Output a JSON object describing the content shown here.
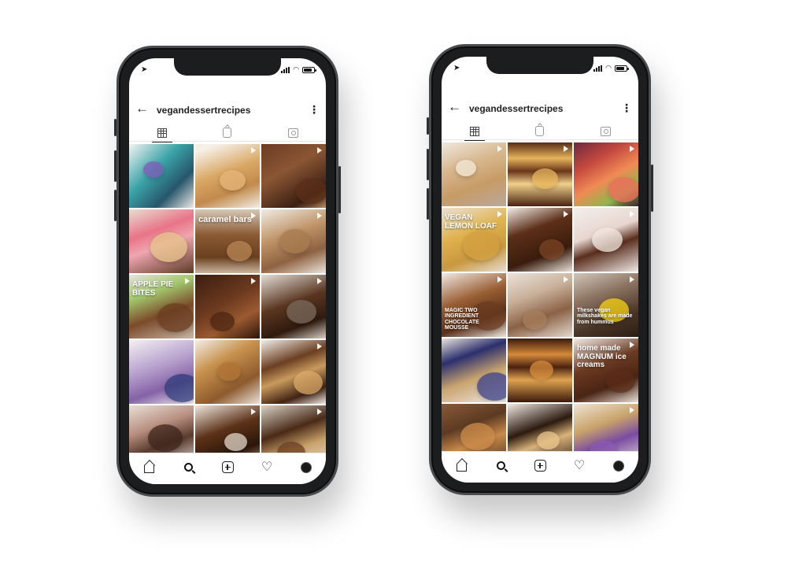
{
  "phones": [
    {
      "username": "vegandessertrecipes",
      "header": {
        "back_icon": "arrow-left-icon",
        "more_icon": "more-vertical-icon"
      },
      "tabs": [
        "grid-icon",
        "igtv-icon",
        "tagged-icon"
      ],
      "posts": [
        {
          "bg": "linear-gradient(135deg,#f4f4f4 0%,#3aa3a8 40%,#27566b 70%,#efe9e6 100%)",
          "video": false,
          "overlay": "",
          "accent": "#7f5ab8"
        },
        {
          "bg": "linear-gradient(160deg,#f6efe6 10%,#d9a764 45%,#c28a4c 70%,#f3ece4 100%)",
          "video": true,
          "overlay": "",
          "accent": "#e6b579"
        },
        {
          "bg": "linear-gradient(150deg,#6b3b23 0%,#8a5634 40%,#3c1f12 80%,#b98a62 100%)",
          "video": true,
          "overlay": "",
          "accent": "#5a2e16"
        },
        {
          "bg": "linear-gradient(160deg,#e8ddd1 0%,#e87487 35%,#f0a6b0 55%,#5c3a25 100%)",
          "video": false,
          "overlay": "",
          "accent": "#e6c58a"
        },
        {
          "bg": "linear-gradient(180deg,#d6c7b5 0%,#8b5a33 40%,#6a401f 75%,#cbb6a0 100%)",
          "video": true,
          "overlay": "caramel bars",
          "accent": "#b88655"
        },
        {
          "bg": "linear-gradient(160deg,#f1ebe4 0%,#bf9468 40%,#8e6241 70%,#ece4dc 100%)",
          "video": true,
          "overlay": "",
          "accent": "#a77a4e"
        },
        {
          "bg": "linear-gradient(160deg,#e7e3de 0%,#a2c66c 30%,#7b4a2a 60%,#c8b6a6 100%)",
          "video": true,
          "overlay": "APPLE PIE BITES",
          "accent": "#6a3c20"
        },
        {
          "bg": "linear-gradient(150deg,#3b1d10 0%,#6d3a1f 45%,#9b5a31 70%,#2d150a 100%)",
          "video": true,
          "overlay": "",
          "accent": "#4b2412"
        },
        {
          "bg": "linear-gradient(160deg,#e3ded8 0%,#5a3620 45%,#2f1a0e 75%,#d7cfc5 100%)",
          "video": true,
          "overlay": "",
          "accent": "#7a6a5c"
        },
        {
          "bg": "linear-gradient(160deg,#f5f0f3 0%,#b9a3cf 40%,#8462a6 70%,#f1ecef 100%)",
          "video": false,
          "overlay": "",
          "accent": "#2d3b7a"
        },
        {
          "bg": "linear-gradient(150deg,#f3ede6 0%,#c8924e 35%,#8d5a2d 70%,#eae3db 100%)",
          "video": false,
          "overlay": "",
          "accent": "#b07234"
        },
        {
          "bg": "linear-gradient(160deg,#f2ede8 0%,#6b3f22 35%,#c99a5d 55%,#412414 80%,#efe9e3 100%)",
          "video": true,
          "overlay": "",
          "accent": "#d8a867"
        },
        {
          "bg": "linear-gradient(160deg,#e9dfd7 0%,#b88f80 35%,#5a3c2e 60%,#f0e7e1 100%)",
          "video": false,
          "overlay": "",
          "accent": "#3b2418"
        },
        {
          "bg": "linear-gradient(160deg,#efe6dd 0%,#5c3218 40%,#2c160a 70%,#caa27a 100%)",
          "video": true,
          "overlay": "",
          "accent": "#e0d6c8"
        },
        {
          "bg": "linear-gradient(160deg,#d9d2c6 0%,#4a2a17 40%,#c9a26a 65%,#e9e2da 100%)",
          "video": true,
          "overlay": "",
          "accent": "#6b3e22"
        }
      ],
      "nav": [
        "home-icon",
        "search-icon",
        "add-post-icon",
        "activity-heart-icon",
        "profile-avatar"
      ]
    },
    {
      "username": "vegandessertrecipes",
      "header": {
        "back_icon": "arrow-left-icon",
        "more_icon": "more-vertical-icon"
      },
      "tabs": [
        "grid-icon",
        "igtv-icon",
        "tagged-icon"
      ],
      "posts": [
        {
          "bg": "linear-gradient(160deg,#efe8df 0%,#d8b88f 35%,#c79b66 65%,#b9a89b 100%)",
          "video": true,
          "overlay": "",
          "accent": "#f3ead8"
        },
        {
          "bg": "linear-gradient(180deg,#5a2c16 0%,#e6b45c 25%,#6a3519 45%,#f0d08a 65%,#4a2312 100%)",
          "video": true,
          "overlay": "",
          "accent": "#e6b45c"
        },
        {
          "bg": "linear-gradient(150deg,#6b2a3f 0%,#c4483f 30%,#f08a55 55%,#8fb64d 80%,#3d1f2c 100%)",
          "video": true,
          "overlay": "",
          "accent": "#f06a5a"
        },
        {
          "bg": "linear-gradient(160deg,#eae1d3 0%,#e0b24e 40%,#c9983f 70%,#e7ddd0 100%)",
          "video": true,
          "overlay": "VEGAN LEMON LOAF",
          "accent": "#d29f3f"
        },
        {
          "bg": "linear-gradient(160deg,#f1ebe6 0%,#5c2f18 35%,#3a1c0d 70%,#e9e1d9 100%)",
          "video": true,
          "overlay": "",
          "accent": "#7a4424"
        },
        {
          "bg": "linear-gradient(160deg,#f3efec 0%,#e8d6cf 40%,#5a2e1e 60%,#efe8e4 100%)",
          "video": true,
          "overlay": "",
          "accent": "#f0e6de"
        },
        {
          "bg": "linear-gradient(160deg,#f0e9e2 0%,#9a5f34 40%,#5a3019 70%,#ede4db 100%)",
          "video": true,
          "overlay": "MAGIC TWO INGREDIENT CHOCOLATE MOUSSE",
          "accent": "#6a3a1e"
        },
        {
          "bg": "linear-gradient(160deg,#ebe3da 0%,#c9b09a 35%,#8b6246 65%,#e3d8cc 100%)",
          "video": true,
          "overlay": "",
          "accent": "#a57d5a"
        },
        {
          "bg": "linear-gradient(160deg,#d2c7bb 0%,#8d7462 35%,#4a3526 70%,#2b1d14 100%)",
          "video": true,
          "overlay": "These vegan milkshakes are made from hummus",
          "accent": "#f5d313"
        },
        {
          "bg": "linear-gradient(160deg,#e9e3de 0%,#2b2f6e 30%,#c9a46f 60%,#efe9e4 100%)",
          "video": false,
          "overlay": "",
          "accent": "#3a3f8a"
        },
        {
          "bg": "linear-gradient(180deg,#3a1a0c 0%,#d58a3a 25%,#4b2210 45%,#e0a350 65%,#3a1a0c 100%)",
          "video": false,
          "overlay": "",
          "accent": "#d58a3a"
        },
        {
          "bg": "linear-gradient(160deg,#f3ece6 0%,#6b3a22 40%,#4a2414 70%,#e7ded5 100%)",
          "video": true,
          "overlay": "home made MAGNUM ice creams",
          "accent": "#5a2c16"
        },
        {
          "bg": "linear-gradient(160deg,#8a5a36 0%,#5c3a22 35%,#c98a4a 60%,#3d2416 100%)",
          "video": false,
          "overlay": "",
          "accent": "#c98a4a"
        },
        {
          "bg": "linear-gradient(160deg,#f1eae3 0%,#2c1a10 40%,#d9b27a 60%,#1f120a 100%)",
          "video": false,
          "overlay": "",
          "accent": "#e8c48a"
        },
        {
          "bg": "linear-gradient(160deg,#efe4d6 0%,#c9a36a 35%,#7a4ca1 60%,#ede6dd 100%)",
          "video": true,
          "overlay": "",
          "accent": "#8a5ab0"
        }
      ],
      "nav": [
        "home-icon",
        "search-icon",
        "add-post-icon",
        "activity-heart-icon",
        "profile-avatar"
      ]
    }
  ]
}
